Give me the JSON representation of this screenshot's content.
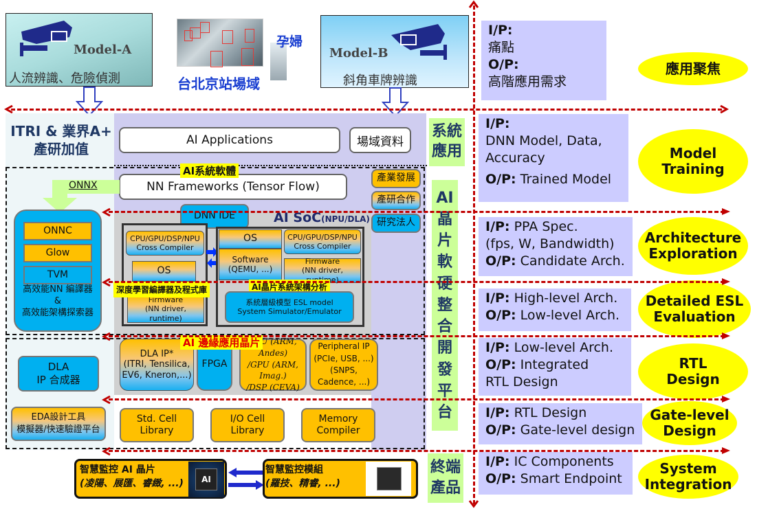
{
  "top": {
    "model_a": {
      "title": "Model-A",
      "caption": "人流辨識、危險偵測"
    },
    "scene": {
      "label": "台北京站場域",
      "tag": "孕婦"
    },
    "model_b": {
      "title": "Model-B",
      "caption": "斜角車牌辨識"
    }
  },
  "left": {
    "title_line1": "ITRI & 業界A+",
    "title_line2": "產研加值",
    "onnx": "ONNX",
    "compiler": {
      "items": [
        "ONNC",
        "Glow",
        "TVM"
      ],
      "caption_line1": "高效能NN 編譯器",
      "caption_line2": "&",
      "caption_line3": "高效能架構探索器"
    },
    "dla_synth": {
      "line1": "DLA",
      "line2": "IP 合成器"
    },
    "eda": {
      "line1": "EDA設計工具",
      "line2": "模擬器/快速驗證平台"
    }
  },
  "middle": {
    "ai_applications": "AI  Applications",
    "domain_data": "場域資料",
    "system_software_tag": "AI系統軟體",
    "nn_frameworks": "NN Frameworks (Tensor Flow)",
    "side_tags": [
      "產業發展",
      "產研合作",
      "研究法人"
    ],
    "dnn_ide": "DNN IDE",
    "soc_title": "AI SoC",
    "soc_subtitle": "(NPU/DLA)",
    "left_stack": {
      "cross_compiler": [
        "CPU/GPU/DSP/NPU",
        "Cross Compiler"
      ],
      "os": "OS",
      "tag": "深度學習編譯器及程式庫",
      "firmware": [
        "Firmware",
        "(NN driver, runtime)"
      ]
    },
    "right_stack": {
      "os": "OS",
      "software": [
        "Software",
        "(QEMU, ...)"
      ],
      "cross_compiler": [
        "CPU/GPU/DSP/NPU",
        "Cross Compiler"
      ],
      "firmware": [
        "Firmware",
        "(NN driver, runtime)"
      ],
      "tag": "AI晶片系統架構分析",
      "esl": [
        "系統層級模型 ESL model",
        "System Simulator/Emulator"
      ]
    },
    "edge_tag": "AI 邊緣應用晶片",
    "ip_blocks": {
      "dla": [
        "DLA  IP*",
        "(ITRI, Tensilica,",
        "EV6, Kneron,...)"
      ],
      "fpga": "FPGA",
      "cpu": [
        "CPU (ARM, Andes)",
        "/GPU (ARM, Imag.)",
        "/DSP (CEVA)"
      ],
      "peripheral": [
        "Peripheral IP",
        "(PCIe, USB, ...)",
        "(SNPS, Cadence, ...)"
      ]
    },
    "libraries": [
      [
        "Std. Cell",
        "Library"
      ],
      [
        "I/O Cell",
        "Library"
      ],
      [
        "Memory",
        "Compiler"
      ]
    ],
    "bottom": {
      "chip": [
        "智慧監控 AI 晶片",
        "(凌陽、展匯、睿緻, ...)"
      ],
      "chip_icon": "AI",
      "module": [
        "智慧監控模組",
        "(羅技、精睿, ...)"
      ]
    }
  },
  "vertical_labels": {
    "system_app": [
      "系統",
      "應用"
    ],
    "platform": [
      "AI",
      "晶",
      "片",
      "軟",
      "硬",
      "整",
      "合",
      "開",
      "發",
      "平",
      "台"
    ],
    "endpoint": [
      "終端",
      "產品"
    ]
  },
  "stages": [
    {
      "ip_label": "I/P:",
      "ip_text": "",
      "ip_line2": "痛點",
      "op_label": "O/P:",
      "op_text": "",
      "op_line2": "高階應用需求",
      "stage": [
        "應用聚焦"
      ]
    },
    {
      "ip_label": "I/P:",
      "ip_line2": "DNN Model, Data,",
      "ip_line3": "Accuracy",
      "op_label": "O/P:",
      "op_text": " Trained Model",
      "stage": [
        "Model",
        "Training"
      ]
    },
    {
      "ip_label": "I/P:",
      "ip_text": " PPA Spec.",
      "ip_line2": "(fps, W, Bandwidth)",
      "op_label": "O/P:",
      "op_text": " Candidate Arch.",
      "stage": [
        "Architecture",
        "Exploration"
      ]
    },
    {
      "ip_label": "I/P:",
      "ip_text": " High-level Arch.",
      "op_label": "O/P:",
      "op_text": " Low-level Arch.",
      "stage": [
        "Detailed ESL",
        "Evaluation"
      ]
    },
    {
      "ip_label": "I/P:",
      "ip_text": " Low-level Arch.",
      "op_label": "O/P:",
      "op_text": " Integrated",
      "op_line2": "RTL Design",
      "stage": [
        "RTL",
        "Design"
      ]
    },
    {
      "ip_label": "I/P:",
      "ip_text": " RTL Design",
      "op_label": "O/P:",
      "op_text": " Gate-level design",
      "stage": [
        "Gate-level",
        "Design"
      ]
    },
    {
      "ip_label": "I/P:",
      "ip_text": " IC Components",
      "op_label": "O/P:",
      "op_text": " Smart Endpoint",
      "stage": [
        "System",
        "Integration"
      ]
    }
  ]
}
